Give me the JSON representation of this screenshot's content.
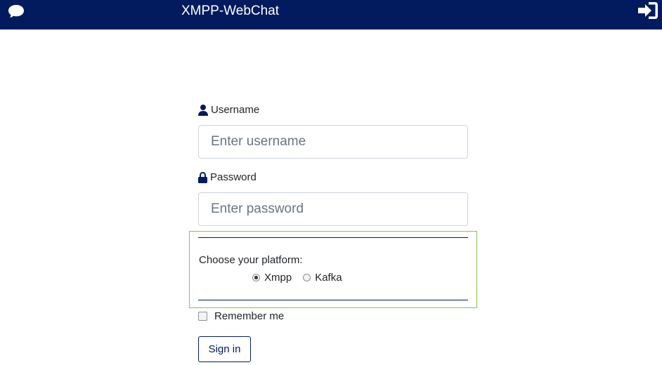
{
  "header": {
    "title": "XMPP-WebChat",
    "left_icon": "chat-bubble-icon",
    "right_icon": "sign-in-icon",
    "background": "#021b5e"
  },
  "form": {
    "username": {
      "label": "Username",
      "icon": "user-icon",
      "placeholder": "Enter username",
      "value": ""
    },
    "password": {
      "label": "Password",
      "icon": "lock-icon",
      "placeholder": "Enter password",
      "value": ""
    },
    "platform": {
      "prompt": "Choose your platform:",
      "options": [
        {
          "label": "Xmpp",
          "selected": true
        },
        {
          "label": "Kafka",
          "selected": false
        }
      ]
    },
    "remember_me": {
      "label": "Remember me",
      "checked": false
    },
    "submit_label": "Sign in"
  },
  "colors": {
    "brand": "#021b5e",
    "platform_border": "#8bc34a"
  }
}
